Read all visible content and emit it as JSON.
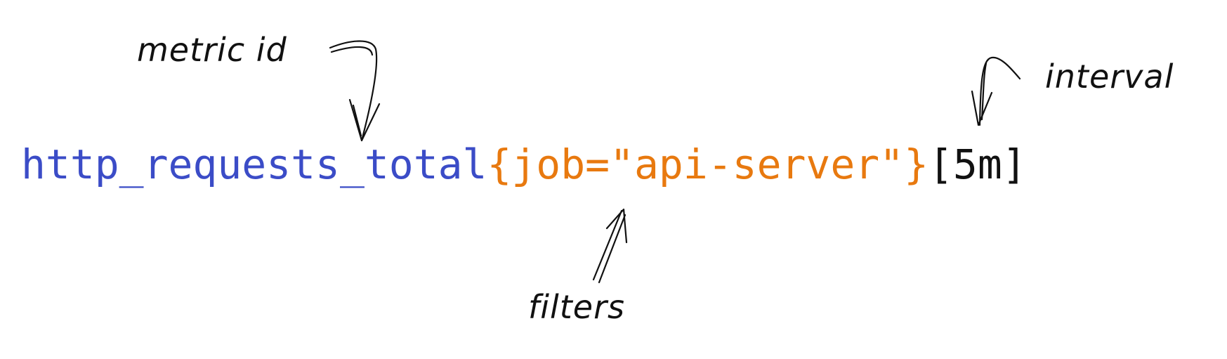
{
  "query": {
    "metric": "http_requests_total",
    "filter": "{job=\"api-server\"}",
    "interval": "[5m]"
  },
  "annotations": {
    "metric_label": "metric id",
    "interval_label": "interval",
    "filters_label": "filters"
  },
  "colors": {
    "metric": "#3b4cc7",
    "filter": "#e8790f",
    "interval": "#111111",
    "annotation": "#111111",
    "background": "#ffffff"
  },
  "icons": {
    "metric_arrow": "hand-drawn-arrow-down-icon",
    "interval_arrow": "hand-drawn-arrow-down-icon",
    "filters_arrow": "hand-drawn-arrow-up-icon"
  }
}
